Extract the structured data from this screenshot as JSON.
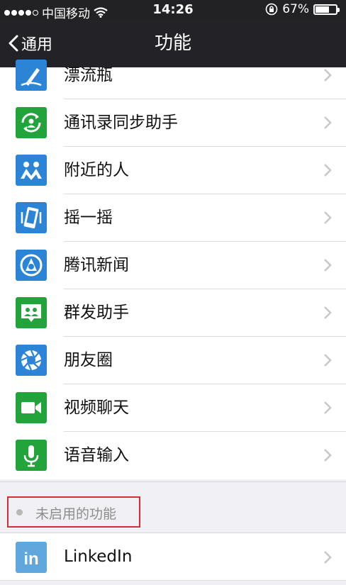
{
  "status": {
    "carrier": "中国移动",
    "time": "14:26",
    "battery": "67%",
    "battery_level": 0.67
  },
  "nav": {
    "back_label": "通用",
    "title": "功能"
  },
  "features": [
    {
      "label": "漂流瓶",
      "icon": "drift-bottle-icon",
      "color": "#2b84d6"
    },
    {
      "label": "通讯录同步助手",
      "icon": "contacts-sync-icon",
      "color": "#22a43b"
    },
    {
      "label": "附近的人",
      "icon": "people-nearby-icon",
      "color": "#2b84d6"
    },
    {
      "label": "摇一摇",
      "icon": "shake-icon",
      "color": "#2b84d6"
    },
    {
      "label": "腾讯新闻",
      "icon": "tencent-news-icon",
      "color": "#2b84d6"
    },
    {
      "label": "群发助手",
      "icon": "broadcast-icon",
      "color": "#22a43b"
    },
    {
      "label": "朋友圈",
      "icon": "moments-icon",
      "color": "#2b84d6"
    },
    {
      "label": "视频聊天",
      "icon": "video-chat-icon",
      "color": "#22a43b"
    },
    {
      "label": "语音输入",
      "icon": "voice-input-icon",
      "color": "#22a43b"
    }
  ],
  "disabled_section": {
    "header": "未启用的功能"
  },
  "disabled_features": [
    {
      "label": "LinkedIn",
      "icon": "linkedin-icon",
      "icon_text": "in",
      "color": "#5fa7dc"
    }
  ]
}
